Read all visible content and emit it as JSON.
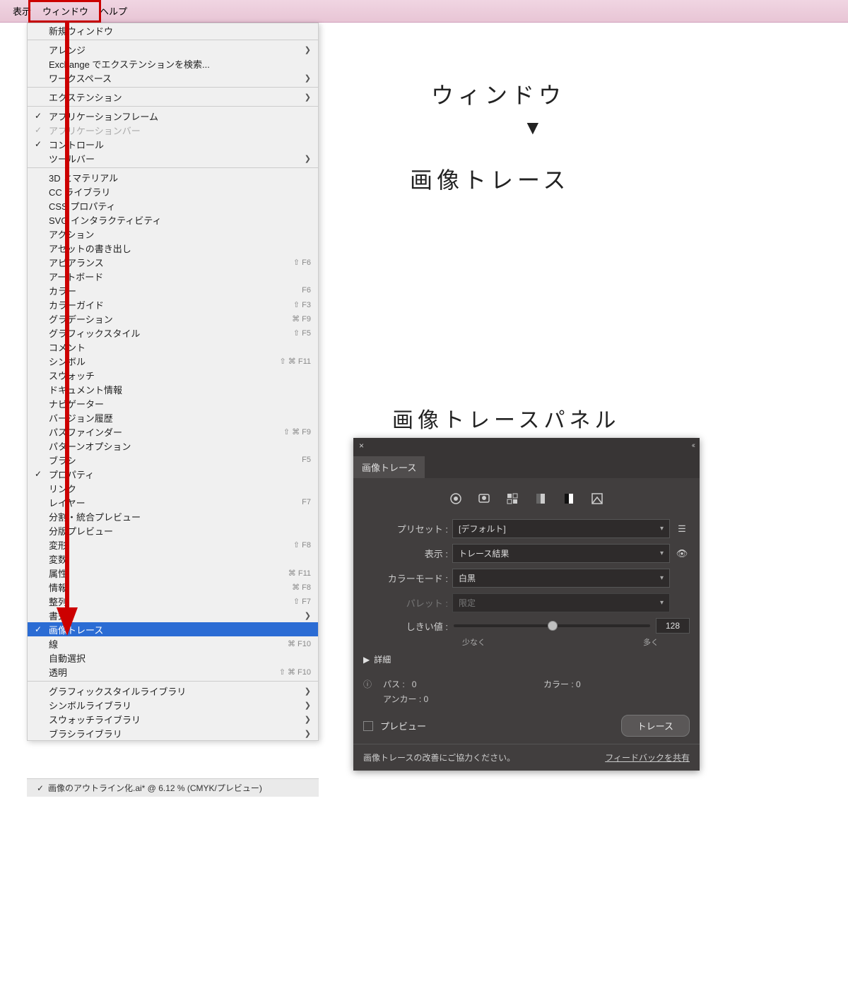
{
  "menubar": {
    "items": [
      "表示",
      "ウィンドウ",
      "ヘルプ"
    ]
  },
  "menu": {
    "g1": [
      {
        "label": "新規ウィンドウ"
      }
    ],
    "g2": [
      {
        "label": "アレンジ",
        "sub": true
      },
      {
        "label": "Exchange でエクステンションを検索..."
      },
      {
        "label": "ワークスペース",
        "sub": true
      }
    ],
    "g3": [
      {
        "label": "エクステンション",
        "sub": true
      }
    ],
    "g4": [
      {
        "label": "アプリケーションフレーム",
        "check": true
      },
      {
        "label": "アプリケーションバー",
        "check": true,
        "disabled": true
      },
      {
        "label": "コントロール",
        "check": true
      },
      {
        "label": "ツールバー",
        "sub": true
      }
    ],
    "g5": [
      {
        "label": "3D とマテリアル"
      },
      {
        "label": "CC ライブラリ"
      },
      {
        "label": "CSS プロパティ"
      },
      {
        "label": "SVG インタラクティビティ"
      },
      {
        "label": "アクション"
      },
      {
        "label": "アセットの書き出し"
      },
      {
        "label": "アピアランス",
        "shortcut": "⇧ F6"
      },
      {
        "label": "アートボード"
      },
      {
        "label": "カラー",
        "shortcut": "F6"
      },
      {
        "label": "カラーガイド",
        "shortcut": "⇧ F3"
      },
      {
        "label": "グラデーション",
        "shortcut": "⌘ F9"
      },
      {
        "label": "グラフィックスタイル",
        "shortcut": "⇧ F5"
      },
      {
        "label": "コメント"
      },
      {
        "label": "シンボル",
        "shortcut": "⇧ ⌘ F11"
      },
      {
        "label": "スウォッチ"
      },
      {
        "label": "ドキュメント情報"
      },
      {
        "label": "ナビゲーター"
      },
      {
        "label": "バージョン履歴"
      },
      {
        "label": "パスファインダー",
        "shortcut": "⇧ ⌘ F9"
      },
      {
        "label": "パターンオプション"
      },
      {
        "label": "ブラシ",
        "shortcut": "F5"
      },
      {
        "label": "プロパティ",
        "check": true
      },
      {
        "label": "リンク"
      },
      {
        "label": "レイヤー",
        "shortcut": "F7"
      },
      {
        "label": "分割・統合プレビュー"
      },
      {
        "label": "分版プレビュー"
      },
      {
        "label": "変形",
        "shortcut": "⇧ F8"
      },
      {
        "label": "変数"
      },
      {
        "label": "属性",
        "shortcut": "⌘ F11"
      },
      {
        "label": "情報",
        "shortcut": "⌘ F8"
      },
      {
        "label": "整列",
        "shortcut": "⇧ F7"
      },
      {
        "label": "書式",
        "sub": true
      },
      {
        "label": "画像トレース",
        "check": true,
        "selected": true
      },
      {
        "label": "線",
        "shortcut": "⌘ F10"
      },
      {
        "label": "自動選択"
      },
      {
        "label": "透明",
        "shortcut": "⇧ ⌘ F10"
      }
    ],
    "g6": [
      {
        "label": "グラフィックスタイルライブラリ",
        "sub": true
      },
      {
        "label": "シンボルライブラリ",
        "sub": true
      },
      {
        "label": "スウォッチライブラリ",
        "sub": true
      },
      {
        "label": "ブラシライブラリ",
        "sub": true
      }
    ]
  },
  "statusbar": "画像のアウトライン化.ai* @ 6.12 % (CMYK/プレビュー)",
  "captions": {
    "c1": "ウィンドウ",
    "c1b": "▼",
    "c2": "画像トレース",
    "c3": "画像トレースパネル"
  },
  "panel": {
    "title": "画像トレース",
    "preset_label": "プリセット :",
    "preset_value": "[デフォルト]",
    "view_label": "表示 :",
    "view_value": "トレース結果",
    "mode_label": "カラーモード :",
    "mode_value": "白黒",
    "palette_label": "パレット :",
    "palette_value": "限定",
    "threshold_label": "しきい値 :",
    "threshold_value": "128",
    "slider_min": "少なく",
    "slider_max": "多く",
    "detail": "詳細",
    "paths_label": "パス :",
    "paths_value": "0",
    "colors_label": "カラー :",
    "colors_value": "0",
    "anchors_label": "アンカー :",
    "anchors_value": "0",
    "preview": "プレビュー",
    "trace_btn": "トレース",
    "feedback_text": "画像トレースの改善にご協力ください。",
    "feedback_link": "フィードバックを共有"
  }
}
